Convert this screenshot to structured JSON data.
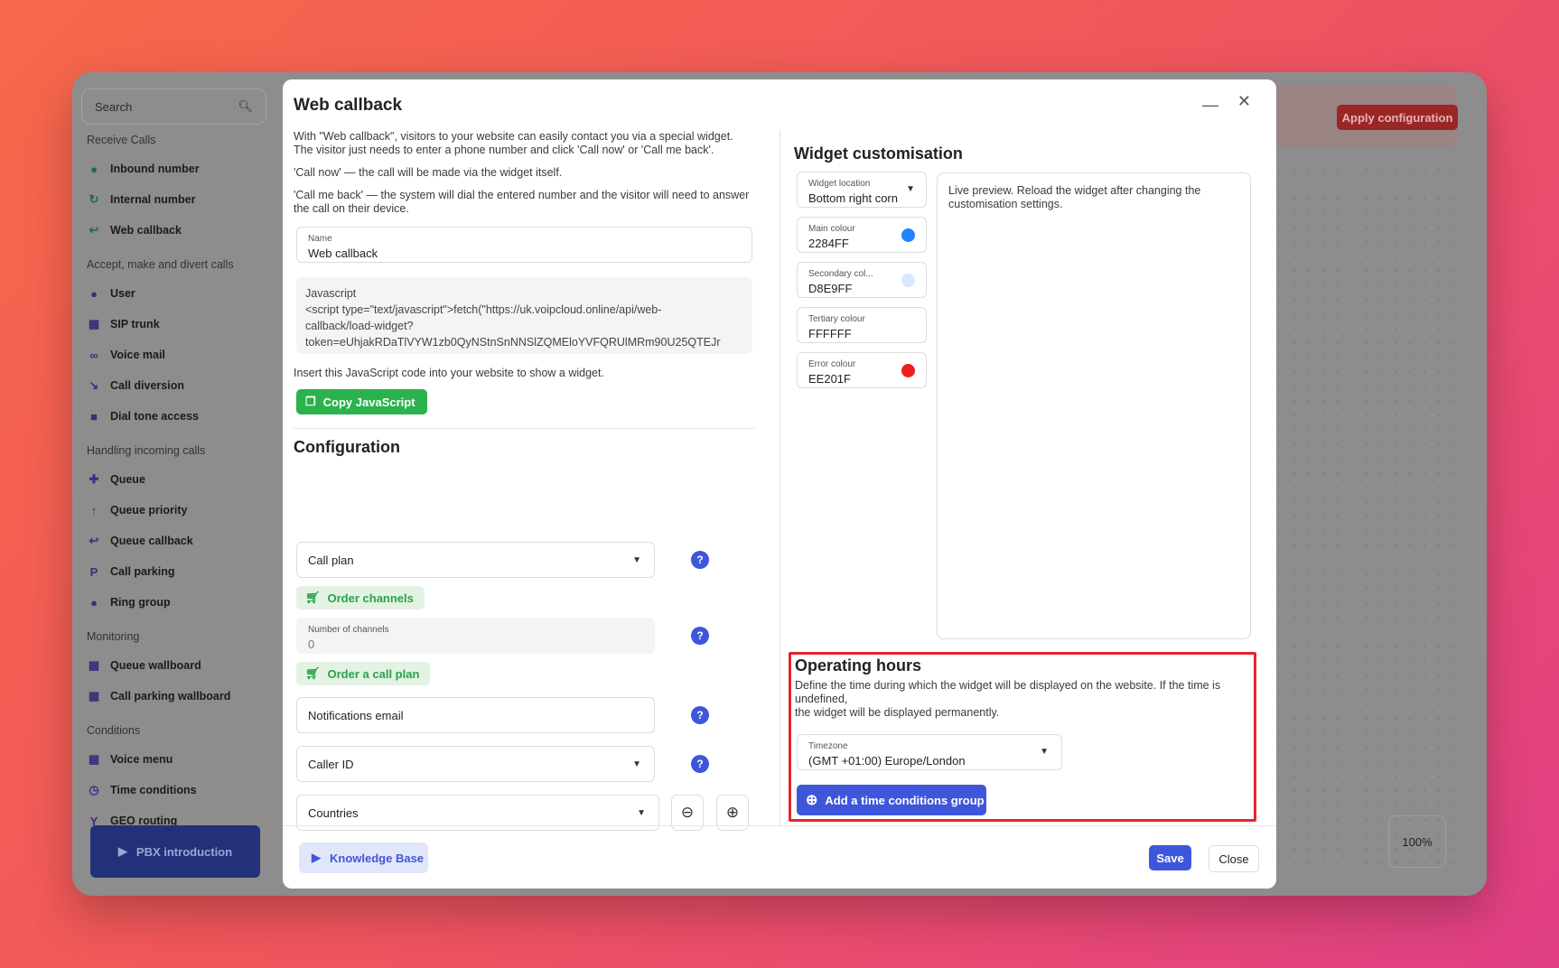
{
  "sidebar": {
    "search_placeholder": "Search",
    "sections": [
      {
        "title": "Receive Calls",
        "items": [
          {
            "label": "Inbound number",
            "icon": "green-circle-icon"
          },
          {
            "label": "Internal number",
            "icon": "arrow-circle-icon"
          },
          {
            "label": "Web callback",
            "icon": "reply-arrow-icon"
          }
        ]
      },
      {
        "title": "Accept, make and divert calls",
        "items": [
          {
            "label": "User",
            "icon": "user-icon"
          },
          {
            "label": "SIP trunk",
            "icon": "sip-trunk-icon"
          },
          {
            "label": "Voice mail",
            "icon": "voicemail-icon"
          },
          {
            "label": "Call diversion",
            "icon": "diversion-arrow-icon"
          },
          {
            "label": "Dial tone access",
            "icon": "lock-icon"
          }
        ]
      },
      {
        "title": "Handling incoming calls",
        "items": [
          {
            "label": "Queue",
            "icon": "add-user-icon"
          },
          {
            "label": "Queue priority",
            "icon": "arrow-up-icon"
          },
          {
            "label": "Queue callback",
            "icon": "reply-all-icon"
          },
          {
            "label": "Call parking",
            "icon": "parking-icon"
          },
          {
            "label": "Ring group",
            "icon": "group-icon"
          }
        ]
      },
      {
        "title": "Monitoring",
        "items": [
          {
            "label": "Queue wallboard",
            "icon": "dashboard-icon"
          },
          {
            "label": "Call parking wallboard",
            "icon": "dashboard-icon"
          }
        ]
      },
      {
        "title": "Conditions",
        "items": [
          {
            "label": "Voice menu",
            "icon": "grid-icon"
          },
          {
            "label": "Time conditions",
            "icon": "clock-icon"
          },
          {
            "label": "GEO routing",
            "icon": "fork-icon"
          }
        ]
      }
    ],
    "pbx_label": "PBX introduction"
  },
  "topbar": {
    "apply_label": "Apply configuration"
  },
  "zoom": "100%",
  "modal": {
    "title": "Web callback",
    "intro": "With \"Web callback\", visitors to your website can easily contact you via a special widget. The visitor just needs to enter a phone number and click 'Call now' or 'Call me back'.",
    "call_now": "'Call now' — the call will be made via the widget itself.",
    "call_me_back": "'Call me back' — the system will dial the entered number and the visitor will need to answer the call on their device.",
    "name_label": "Name",
    "name_value": "Web callback",
    "js_label": "Javascript",
    "js_line1": "<script type=\"text/javascript\">fetch(\"https://uk.voipcloud.online/api/web-",
    "js_line2": "callback/load-widget?",
    "js_line3": "token=eUhjakRDaTlVYW1zb0QyNStnSnNNSlZQMEloYVFQRUlMRm90U25QTEJr",
    "insert_text": "Insert this JavaScript code into your website to show a widget.",
    "copy_js": "Copy JavaScript",
    "config_title": "Configuration",
    "call_plan": "Call plan",
    "order_channels": "Order channels",
    "channels_label": "Number of channels",
    "channels_value": "0",
    "order_call_plan": "Order a call plan",
    "notif_email": "Notifications email",
    "caller_id": "Caller ID",
    "countries": "Countries",
    "help": "?",
    "widget_title": "Widget customisation",
    "location_label": "Widget location",
    "location_value": "Bottom right corn",
    "main_label": "Main colour",
    "main_value": "2284FF",
    "secondary_label": "Secondary col...",
    "secondary_value": "D8E9FF",
    "tertiary_label": "Tertiary colour",
    "tertiary_value": "FFFFFF",
    "error_label": "Error colour",
    "error_value": "EE201F",
    "preview_text": "Live preview. Reload the widget after changing the customisation settings.",
    "op_title": "Operating hours",
    "op_line1": "Define the time during which the widget will be displayed on the website. If the time is undefined,",
    "op_line2": "the widget will be displayed permanently.",
    "tz_label": "Timezone",
    "tz_value": "(GMT +01:00) Europe/London",
    "add_tc": "Add a time conditions group",
    "kb": "Knowledge Base",
    "save": "Save",
    "close": "Close"
  },
  "colors": {
    "main": "#2284FF",
    "secondary": "#D8E9FF",
    "error": "#EE201F",
    "accent": "#3E57DA",
    "green": "#2BB24C",
    "highlight": "#E2262F"
  }
}
